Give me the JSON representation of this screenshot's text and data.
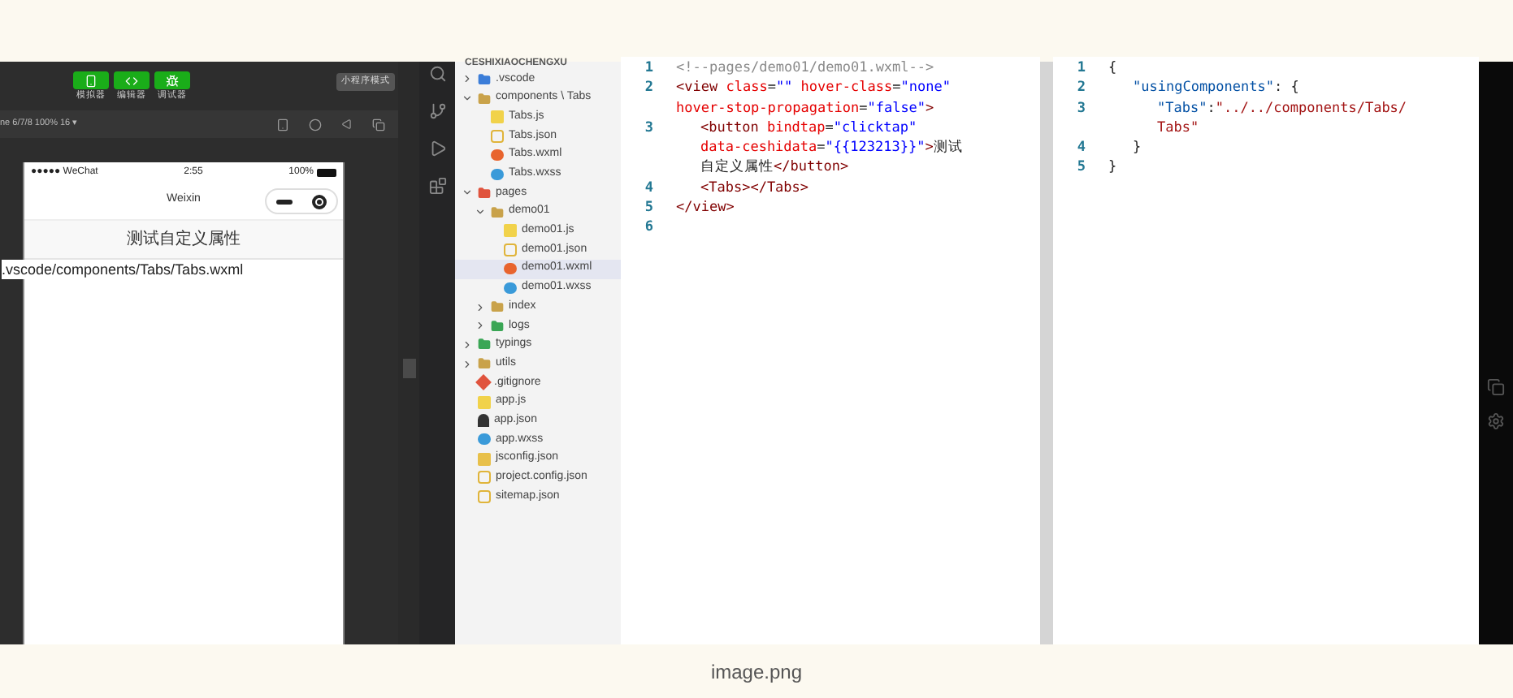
{
  "simulator": {
    "toolbar_buttons": [
      {
        "label": "模拟器",
        "kind": "phone"
      },
      {
        "label": "编辑器",
        "kind": "code"
      },
      {
        "label": "调试器",
        "kind": "debug"
      }
    ],
    "mode_button": "小程序模式",
    "device": "ne 6/7/8 100% 16 ▾",
    "phone": {
      "carrier": "●●●●● WeChat",
      "time": "2:55",
      "battery": "100%",
      "nav_title": "Weixin",
      "button_label": "测试自定义属性",
      "content": ".vscode/components/Tabs/Tabs.wxml"
    }
  },
  "explorer": {
    "title": "CESHIXIAOCHENGXU",
    "tree": [
      {
        "label": ".vscode",
        "kind": "folder-blue",
        "expanded": false,
        "selected": false
      },
      {
        "label": "components \\ Tabs",
        "kind": "folder",
        "expanded": true,
        "selected": false,
        "children": [
          {
            "label": "Tabs.js",
            "kind": "js",
            "selected": false
          },
          {
            "label": "Tabs.json",
            "kind": "json",
            "selected": false
          },
          {
            "label": "Tabs.wxml",
            "kind": "wxml",
            "selected": false
          },
          {
            "label": "Tabs.wxss",
            "kind": "wxss",
            "selected": false
          }
        ]
      },
      {
        "label": "pages",
        "kind": "folder-red",
        "expanded": true,
        "selected": false,
        "children": [
          {
            "label": "demo01",
            "kind": "folder",
            "expanded": true,
            "selected": false,
            "children": [
              {
                "label": "demo01.js",
                "kind": "js",
                "selected": false
              },
              {
                "label": "demo01.json",
                "kind": "json",
                "selected": false
              },
              {
                "label": "demo01.wxml",
                "kind": "wxml",
                "selected": true
              },
              {
                "label": "demo01.wxss",
                "kind": "wxss",
                "selected": false
              }
            ]
          },
          {
            "label": "index",
            "kind": "folder",
            "expanded": false,
            "selected": false
          },
          {
            "label": "logs",
            "kind": "folder-green",
            "expanded": false,
            "selected": false
          }
        ]
      },
      {
        "label": "typings",
        "kind": "folder-green",
        "expanded": false,
        "selected": false
      },
      {
        "label": "utils",
        "kind": "folder",
        "expanded": false,
        "selected": false
      },
      {
        "label": ".gitignore",
        "kind": "git",
        "selected": false
      },
      {
        "label": "app.js",
        "kind": "js",
        "selected": false
      },
      {
        "label": "app.json",
        "kind": "app",
        "selected": false
      },
      {
        "label": "app.wxss",
        "kind": "wxss",
        "selected": false
      },
      {
        "label": "jsconfig.json",
        "kind": "jsconfig",
        "selected": false
      },
      {
        "label": "project.config.json",
        "kind": "json",
        "selected": false
      },
      {
        "label": "sitemap.json",
        "kind": "json",
        "selected": false
      }
    ]
  },
  "editor_left": {
    "lines": [
      {
        "number": "1",
        "wrapped": [
          {
            "tokens": [
              {
                "kind": "comment",
                "text": "<!--pages/demo01/demo01.wxml-->"
              }
            ]
          }
        ]
      },
      {
        "number": "2",
        "wrapped": [
          {
            "tokens": [
              {
                "kind": "tag",
                "text": "<view "
              },
              {
                "kind": "attr",
                "text": "class"
              },
              {
                "kind": "plain",
                "text": "="
              },
              {
                "kind": "value",
                "text": "\"\""
              },
              {
                "kind": "attr",
                "text": " hover-class"
              },
              {
                "kind": "plain",
                "text": "="
              },
              {
                "kind": "value",
                "text": "\"none\""
              }
            ]
          },
          {
            "tokens": [
              {
                "kind": "attr",
                "text": "hover-stop-propagation"
              },
              {
                "kind": "plain",
                "text": "="
              },
              {
                "kind": "value",
                "text": "\"false\""
              },
              {
                "kind": "tag",
                "text": ">"
              }
            ]
          }
        ],
        "children": [
          {
            "number": "3",
            "wrapped": [
              {
                "tokens": [
                  {
                    "kind": "tag",
                    "text": "<button "
                  },
                  {
                    "kind": "attr",
                    "text": "bindtap"
                  },
                  {
                    "kind": "plain",
                    "text": "="
                  },
                  {
                    "kind": "value",
                    "text": "\"clicktap\""
                  }
                ]
              },
              {
                "tokens": [
                  {
                    "kind": "attr",
                    "text": "data-ceshidata"
                  },
                  {
                    "kind": "plain",
                    "text": "="
                  },
                  {
                    "kind": "value",
                    "text": "\"{{123213}}\""
                  },
                  {
                    "kind": "tag",
                    "text": ">"
                  },
                  {
                    "kind": "plain",
                    "text": "测试"
                  }
                ]
              },
              {
                "tokens": [
                  {
                    "kind": "plain",
                    "text": "自定义属性"
                  },
                  {
                    "kind": "tag",
                    "text": "</button>"
                  }
                ]
              }
            ]
          },
          {
            "number": "4",
            "wrapped": [
              {
                "tokens": [
                  {
                    "kind": "tag",
                    "text": "<Tabs></Tabs>"
                  }
                ]
              }
            ]
          }
        ]
      },
      {
        "number": "5",
        "wrapped": [
          {
            "tokens": [
              {
                "kind": "tag",
                "text": "</view>"
              }
            ]
          }
        ]
      },
      {
        "number": "6"
      }
    ]
  },
  "editor_right": {
    "lines": [
      {
        "number": "1",
        "wrapped": [
          {
            "tokens": [
              {
                "kind": "plain",
                "text": "{"
              }
            ]
          }
        ],
        "children": [
          {
            "number": "2",
            "wrapped": [
              {
                "tokens": [
                  {
                    "kind": "key",
                    "text": "\"usingComponents\""
                  },
                  {
                    "kind": "plain",
                    "text": ": {"
                  }
                ]
              }
            ],
            "children": [
              {
                "number": "3",
                "wrapped": [
                  {
                    "tokens": [
                      {
                        "kind": "key",
                        "text": "\"Tabs\""
                      },
                      {
                        "kind": "plain",
                        "text": ":"
                      },
                      {
                        "kind": "string",
                        "text": "\"../../components/Tabs/"
                      }
                    ]
                  },
                  {
                    "tokens": [
                      {
                        "kind": "string",
                        "text": "Tabs\""
                      }
                    ]
                  }
                ]
              }
            ]
          },
          {
            "number": "4",
            "wrapped": [
              {
                "tokens": [
                  {
                    "kind": "plain",
                    "text": "}"
                  }
                ]
              }
            ]
          }
        ]
      },
      {
        "number": "5",
        "wrapped": [
          {
            "tokens": [
              {
                "kind": "plain",
                "text": "}"
              }
            ]
          }
        ]
      }
    ]
  },
  "caption": "image.png"
}
